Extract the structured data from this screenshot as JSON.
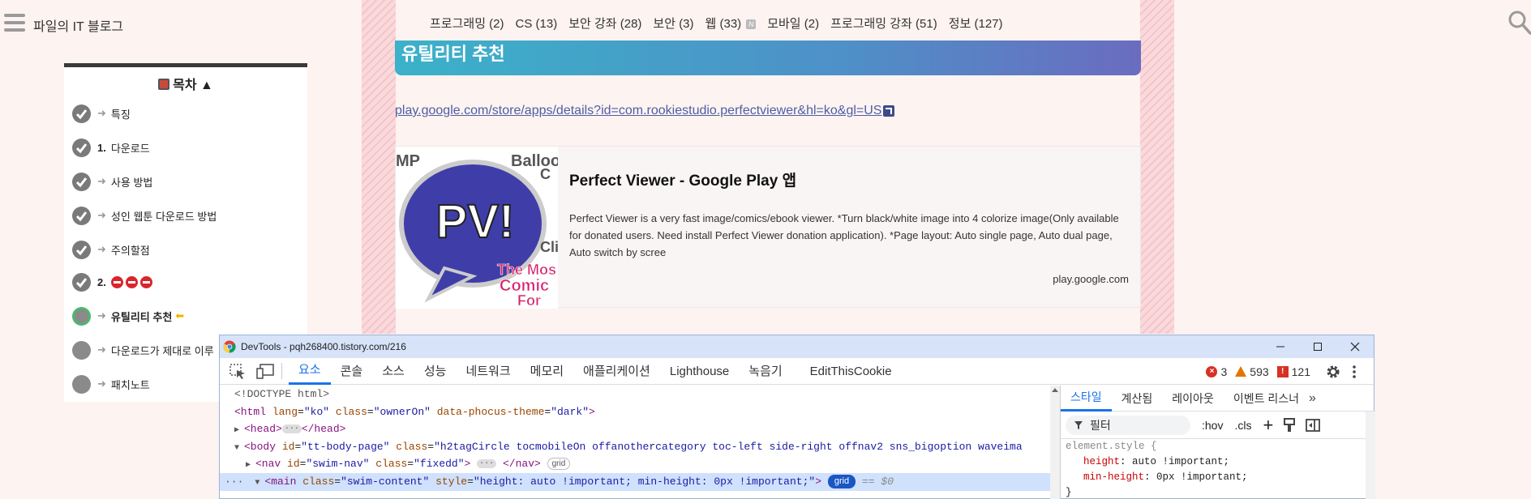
{
  "blog": {
    "title": "파일의 IT 블로그"
  },
  "nav": {
    "items": [
      "프로그래밍 (2)",
      "CS (13)",
      "보안 강좌 (28)",
      "보안 (3)",
      "웹 (33)",
      "모바일 (2)",
      "프로그래밍 강좌 (51)",
      "정보 (127)"
    ],
    "new_badge": "N"
  },
  "toc": {
    "title": "목차 ▲",
    "items": [
      {
        "label": "특징",
        "num": "",
        "state": "done"
      },
      {
        "label": "다운로드",
        "num": "1.",
        "state": "done"
      },
      {
        "label": "사용 방법",
        "num": "",
        "state": "done"
      },
      {
        "label": "성인 웹툰 다운로드 방법",
        "num": "",
        "state": "done"
      },
      {
        "label": "주의할점",
        "num": "",
        "state": "done"
      },
      {
        "label": "",
        "num": "2.",
        "state": "done"
      },
      {
        "label": "유틸리티 추천",
        "num": "",
        "state": "active"
      },
      {
        "label": "다운로드가 제대로 이루",
        "num": "",
        "state": "todo"
      },
      {
        "label": "패치노트",
        "num": "",
        "state": "todo"
      }
    ]
  },
  "content": {
    "heading": "유틸리티 추천",
    "link": "play.google.com/store/apps/details?id=com.rookiestudio.perfectviewer&hl=ko&gl=US",
    "card": {
      "thumb_text": "PV!",
      "thumb_side_text": "The Most Comics For",
      "title": "Perfect Viewer - Google Play 앱",
      "description": "Perfect Viewer is a very fast image/comics/ebook viewer. *Turn black/white image into 4 colorize image(Only available for donated users. Need install Perfect Viewer donation application). *Page layout: Auto single page, Auto dual page, Auto switch by scree",
      "host": "play.google.com"
    }
  },
  "devtools": {
    "window_title": "DevTools - pqh268400.tistory.com/216",
    "tabs": [
      "요소",
      "콘솔",
      "소스",
      "성능",
      "네트워크",
      "메모리",
      "애플리케이션",
      "Lighthouse",
      "녹음기",
      "EditThisCookie"
    ],
    "active_tab": "요소",
    "errors": "3",
    "warnings": "593",
    "issues": "121",
    "elements": {
      "doctype": "<!DOCTYPE html>",
      "html_open": "<html lang=\"ko\" class=\"ownerOn\" data-phocus-theme=\"dark\">",
      "head": "<head>",
      "head_close": "</head>",
      "body": "<body id=\"tt-body-page\" class=\"h2tagCircle tocmobileOn offanothercategory toc-left side-right offnav2 sns_bigoption waveima",
      "nav": "<nav id=\"swim-nav\" class=\"fixedd\">",
      "nav_close": "</nav>",
      "nav_badge": "grid",
      "main": "<main class=\"swim-content\" style=\"height: auto !important; min-height: 0px !important;\">",
      "main_badge": "grid",
      "main_ref": "== $0"
    },
    "styles": {
      "tabs": [
        "스타일",
        "계산됨",
        "레이아웃",
        "이벤트 리스너"
      ],
      "active_tab": "스타일",
      "filter_placeholder": "필터",
      "hov": ":hov",
      "cls": ".cls",
      "selector": "element.style {",
      "prop1": "height",
      "val1": "auto !important;",
      "prop2": "min-height",
      "val2": "0px !important;",
      "close": "}"
    }
  }
}
